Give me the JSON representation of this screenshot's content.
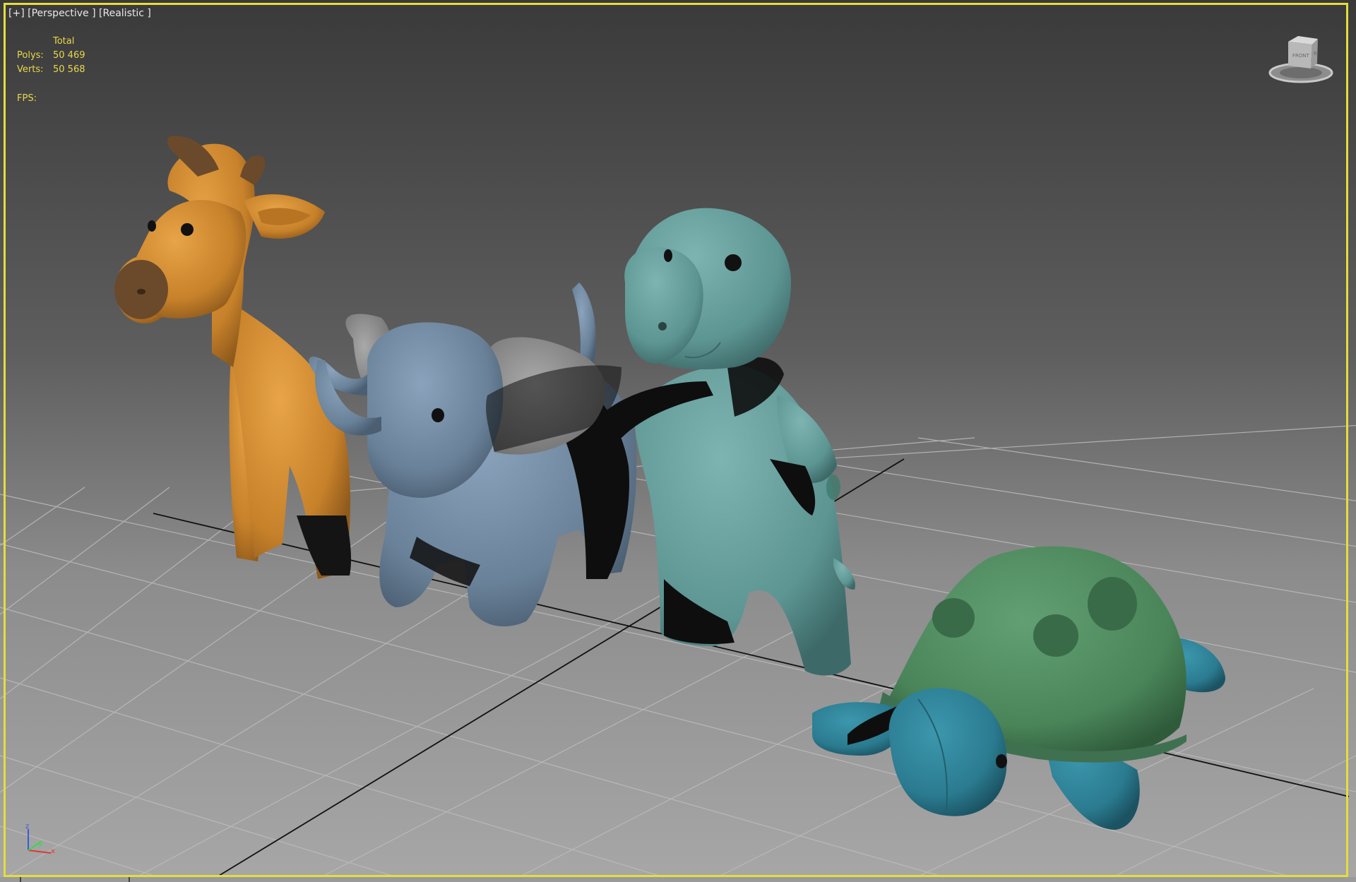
{
  "viewport": {
    "label_plus": "[+]",
    "label_view": "[Perspective ]",
    "label_shading": "[Realistic ]",
    "active_border_color": "#e4de3c"
  },
  "stats": {
    "header": "Total",
    "polys_label": "Polys:",
    "polys_value": "50 469",
    "verts_label": "Verts:",
    "verts_value": "50 568",
    "fps_label": "FPS:",
    "text_color": "#e9d84a"
  },
  "viewcube": {
    "face_label": "FRONT",
    "face_side": "R"
  },
  "axis_tripod": {
    "z": "z",
    "y": "y",
    "x": "x"
  },
  "scene": {
    "objects": [
      {
        "name": "giraffe",
        "color": "#d08a2e"
      },
      {
        "name": "elephant",
        "color": "#6d86a0"
      },
      {
        "name": "dinosaur",
        "color": "#5f9896"
      },
      {
        "name": "turtle",
        "shell_color": "#4e8a5e",
        "body_color": "#2f7f96"
      }
    ],
    "icons": [
      "viewcube-icon",
      "axis-tripod-icon"
    ]
  }
}
